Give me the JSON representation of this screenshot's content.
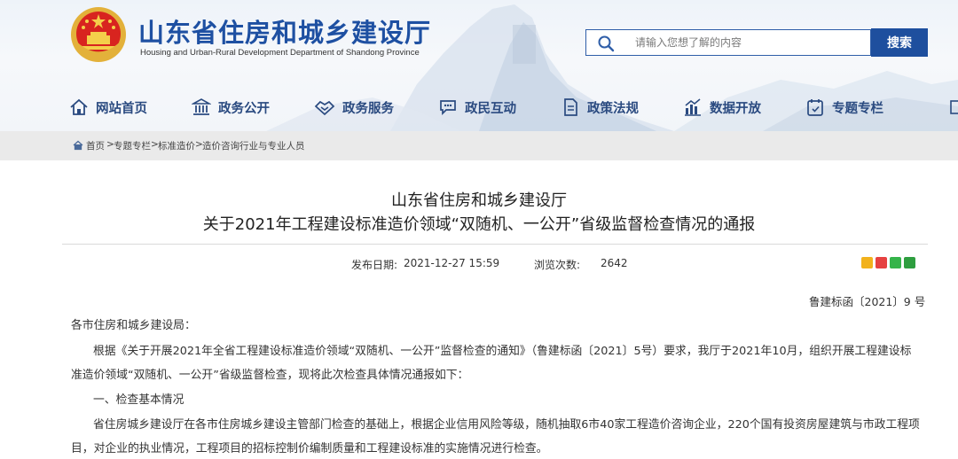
{
  "header": {
    "site_name": "山东省住房和城乡建设厅",
    "site_name_en": "Housing and Urban-Rural Development Department of Shandong Province",
    "search": {
      "placeholder": "请输入您想了解的内容",
      "button_label": "搜索"
    }
  },
  "nav": {
    "items": [
      {
        "label": "网站首页",
        "icon": "home-icon"
      },
      {
        "label": "政务公开",
        "icon": "building-icon"
      },
      {
        "label": "政务服务",
        "icon": "handshake-icon"
      },
      {
        "label": "政民互动",
        "icon": "chat-icon"
      },
      {
        "label": "政策法规",
        "icon": "document-icon"
      },
      {
        "label": "数据开放",
        "icon": "bar-chart-icon"
      },
      {
        "label": "专题专栏",
        "icon": "calendar-icon"
      }
    ]
  },
  "breadcrumb": {
    "items": [
      "首页",
      "专题专栏",
      "标准造价",
      "造价咨询行业与专业人员"
    ],
    "separator": ">"
  },
  "article": {
    "title_line1": "山东省住房和城乡建设厅",
    "title_line2": "关于2021年工程建设标准造价领域“双随机、一公开”省级监督检查情况的通报",
    "publish_label": "发布日期:",
    "publish_date": "2021-12-27 15:59",
    "views_label": "浏览次数:",
    "views": "2642",
    "doc_number": "鲁建标函〔2021〕9 号",
    "salutation": "各市住房和城乡建设局：",
    "para1_line1": "根据《关于开展2021年全省工程建设标准造价领域“双随机、一公开”监督检查的通知》（鲁建标函〔2021〕5号）要求，我厅于2021年10月，组织开展工程建设标",
    "para1_line2": "准造价领域“双随机、一公开”省级监督检查，现将此次检查具体情况通报如下：",
    "section1": "一、检查基本情况",
    "para2_line1": "省住房城乡建设厅在各市住房城乡建设主管部门检查的基础上，根据企业信用风险等级，随机抽取6市40家工程造价咨询企业，220个国有投资房屋建筑与市政工程项",
    "para2_line2": "目，对企业的执业情况，工程项目的招标控制价编制质量和工程建设标准的实施情况进行检查。"
  },
  "share": [
    "qzone-icon",
    "weibo-icon",
    "wechat-icon",
    "douban-icon"
  ],
  "colors": {
    "brand_blue": "#1e50a2",
    "nav_text": "#2a4a80",
    "search_button": "#1e4f9e"
  }
}
